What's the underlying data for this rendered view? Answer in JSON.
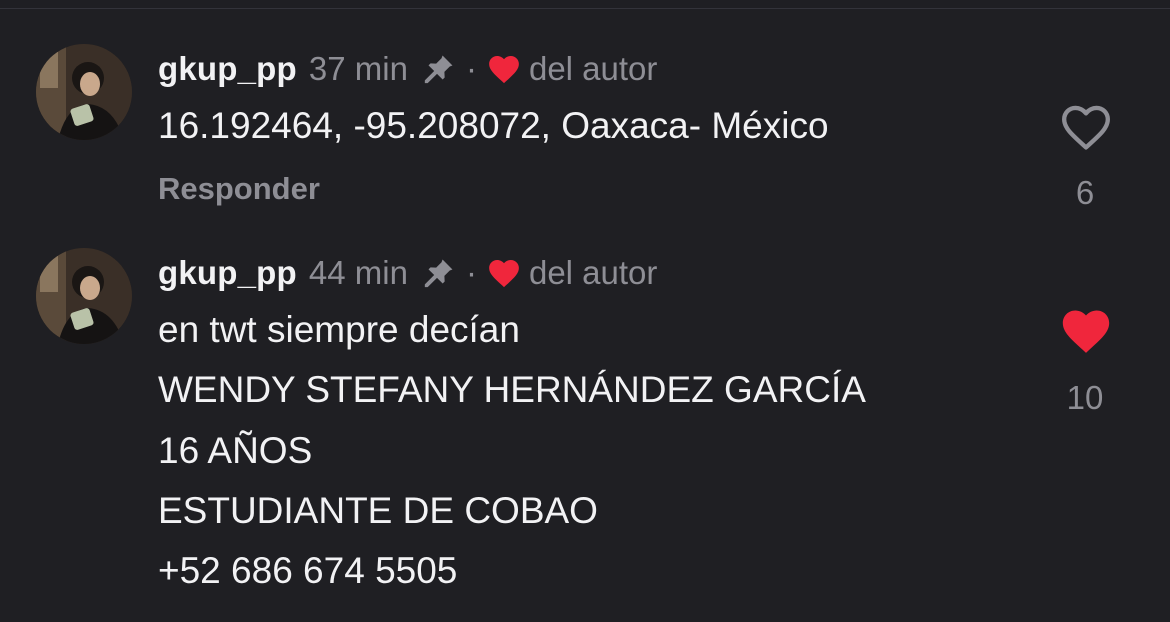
{
  "comments": [
    {
      "username": "gkup_pp",
      "time": "37 min",
      "separator": "·",
      "author_label": "del autor",
      "lines": [
        "16.192464, -95.208072, Oaxaca- México"
      ],
      "reply_label": "Responder",
      "likes": "6",
      "liked": false
    },
    {
      "username": "gkup_pp",
      "time": "44 min",
      "separator": "·",
      "author_label": "del autor",
      "lines": [
        "en twt siempre decían",
        "WENDY STEFANY HERNÁNDEZ GARCÍA",
        "16 AÑOS",
        "ESTUDIANTE DE COBAO",
        "+52 686 674 5505"
      ],
      "likes": "10",
      "liked": true
    }
  ],
  "colors": {
    "background": "#1f1f23",
    "text": "#f2f2f4",
    "muted": "#8e8e95",
    "heart_red": "#f0263c"
  },
  "icons": {
    "pin": "pin-icon",
    "author_heart": "heart-icon",
    "like_outline": "heart-outline-icon",
    "like_filled": "heart-filled-icon"
  }
}
